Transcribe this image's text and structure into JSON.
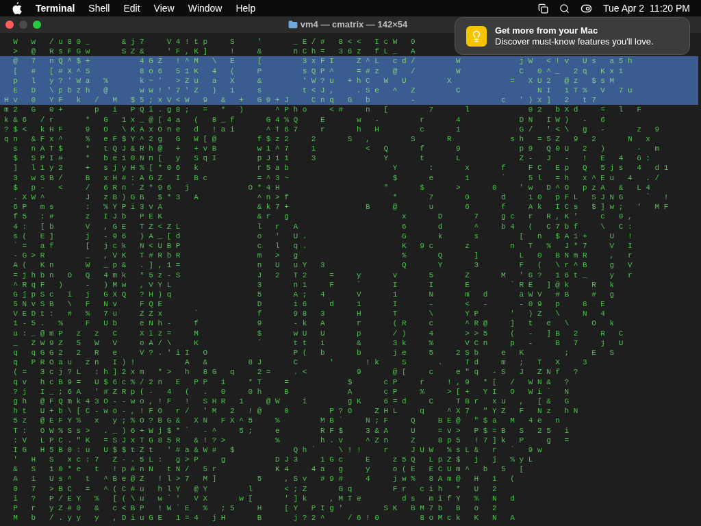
{
  "menu_bar": {
    "app_name": "Terminal",
    "items": [
      "Shell",
      "Edit",
      "View",
      "Window",
      "Help"
    ],
    "date": "Tue Apr 2",
    "time": "11:20 PM"
  },
  "window": {
    "title": "vm4 — cmatrix — 142×54"
  },
  "notification": {
    "title": "Get more from your Mac",
    "body": "Discover must-know features you'll love."
  },
  "terminal": {
    "lines": [
      {
        "text": "  W   w   / u 8 0 _       & j 7     V 4 ! t p     S     '       _ E / #   8 < <   I c W   0",
        "selected": false
      },
      {
        "text": "  >   @   R s F G w       S Z &     ' F , K ]     !     &       n C h =   3 6 z   f L _   A",
        "selected": false
      },
      {
        "text": "  @   7   n Q ^ $ +           4 G Z   ! ^ M   \\   E     [         3 x F I     Z ^ L   c d /         W             j W   < ! v   U s   a 5 h",
        "selected": true
      },
      {
        "text": "  [   #   [ # X ^ S           8 o 6   5 1 K   4   (     P         s Q P ^     = # z   @   /         W             C   0 ^ _   2 q   K x i",
        "selected": true
      },
      {
        "text": "  p   l   y ? ' W a   %       k ~ '   > Z u   a   X     &         ' W ? u   + h C   W   U         X             =   X U 2   @ z   $ s M",
        "selected": true
      },
      {
        "text": "  E   D   \\ p b z h   @       w w ! ' 7 ' Z   )   1     s         t < J ,     . S e   ^   Z         C                 N I   1 T %   V   7 u",
        "selected": true
      },
      {
        "text": "H v   0   Y F   k   /   M   $ 5 ; x V < W   9   &   +   G 9 + J     C n q   G   b         -                   c   ' ) x ]   2   t 7",
        "selected": true
      },
      {
        "text": "m 2   G   0 +       p   i   P Q i . g 8 ;   =   *   )       ^ P h o     < #     n   [         7       l             0 2   b X d     =   l   F",
        "selected": false
      },
      {
        "text": "k & 6   / r       *   G   1 x _ @ [ 4 a   (   8 _ f       G 4 % Q     E       w   -         r       4             D N   I W )   -   6",
        "selected": false
      },
      {
        "text": "? $ <   k H F     9   O   \\ K A x O n e   d   ! a i       ^ T 6 7     r       h   H         c       1             G /   ' < \\   g   -       z   9",
        "selected": false
      },
      {
        "text": "q n   & F x ^     %   e F $ Y ^ 2 g   G   W [ @         f $ z 2     2       S   ,         S       R             s h   = 5 Z   9   2       N   x",
        "selected": false
      },
      {
        "text": "  s   n A T $     *   t Q J & R h @   +   + v B         w 1 ^ 7     1           <   Q       f       9             p 9   Q 0 U   2   )       -   m",
        "selected": false
      },
      {
        "text": "  $   S P I #     *   b e i 0 N n [   y   S q I         p J i 1     3               Y       t       L             Z -   J   -   !   E   4   6 :",
        "selected": false
      },
      {
        "text": "  ]   l 1 y 2     +   s j y H % [ * 0 6   k             r 5 a b                       Y       :       x       f     F C   E p   Q   5 j s   4   d 1",
        "selected": false
      },
      {
        "text": "  3   w S B /     B   x H # : A G Z   I   B c           = ^ 3 ~                       $       e       1       `     5 l   = h   x ^ E u   4   . /",
        "selected": false
      },
      {
        "text": "  $   p -   <     /   6 R n ` Z * 9 6   j             O * 4 H                       \"       $       >       0     ' w   D ^ O   p z A   &   L 4",
        "selected": false
      },
      {
        "text": "  . X W ^         J   z B ) G B   $ * 3   A             ^ n > f                       *       7       0       d     1 0   p F L   S J N G     `   !",
        "selected": false
      },
      {
        "text": "  6 P   m s       :   % Y P i 3 v A                     & k 7 +                 B     @       u       6       f     A k   I C s   $ ] w ;   '   M F",
        "selected": false
      },
      {
        "text": "  f 5   : #       z   I J b   P E K                     & r   g                         x       D       7     g c   r   R , K '     c   0 ,",
        "selected": false
      },
      {
        "text": "  4 :   [ b       V   , G E   T Z < Z L                 l   r   A                       6       d       ^     b 4   (   C 7 b f     \\   C :",
        "selected": false
      },
      {
        "text": "  s (   E ]       j   - 9 6   ) A _ [ d                 o   '   U .                     G       k       s         [   n   $ A 1 +     U   !",
        "selected": false
      },
      {
        "text": "  ` =   a f       [   j c k   N < U B P                 c   l   q .                     K   9 c       z         n   T   %   J * 7     V   I",
        "selected": false
      },
      {
        "text": "  - G > R         _   , V K   T # R b R                 m   >   g                       %       Q       ]         L   0   B N m R     ,   r",
        "selected": false
      },
      {
        "text": "  A (   K n       W   _ p &   . ] , 1 =                 n   U   u Y   3                 Q       Y       3         F   (   \\ r ^ B     g   V",
        "selected": false
      },
      {
        "text": "  = j h b n   O   Q   4 m k   * 5 z - S                 J   2   T 2     =     y       v       5       Z       M   ' G ?   1 6 t _     y   r",
        "selected": false
      },
      {
        "text": "  ^ R q F   )     -   ) M w   , V Y L                   3       n 1     F     `       I       I       E         ` R E   ] @ k     R   k",
        "selected": false
      },
      {
        "text": "  G j p S c   i   j   G X Q   ? H ) q                   5       A ;   4       V       1       N       m   d       a W V   # B     #   g",
        "selected": false
      },
      {
        "text": "  5 N v S B   \\   F   N v     F Q E                     D       i 6     d     1       I       -       <   -       - 0 9   p     8   E",
        "selected": false
      },
      {
        "text": "  V E D t :   #   %   7 u     Z Z x       `             f       9 8   3       H       T       \\       Y P       '   ) Z   \\     N   4",
        "selected": false
      },
      {
        "text": "  i - 5 .   %     F   U b     e N h -     f             9       - k   A       r       ( R     c       ^ R @     ]   t   e   \\     O   k",
        "selected": false
      },
      {
        "text": "  u : _ @ m P   z   z   C     X i z =     M             $       w U   U       p       / )     4       > > 5     (   -   ] B   2     R   C",
        "selected": false
      },
      {
        "text": "  _   Z W 9 Z   5   W   V     o A / \\     K             `       t t   i       &       3 k     %       V C n     p   -     B   7     j   U",
        "selected": false
      },
      {
        "text": "  q   q G G 2   2   R   e     V ? . ' i I   O                   P (   b       b       j e     5     2 S b     e   K         ;     E   S",
        "selected": false
      },
      {
        "text": "  q   P R O a u   z n   I ) !           A   &         8 J       C       '       ! k     S       .     T d     m   ;   T   X     3",
        "selected": false
      },
      {
        "text": "  ( =   3 c j ? L   : h ] 2 x m   * >   h   8 G   q     2 =     . <           9       @ [     c     e \" q   - S   J   Z N f   ?",
        "selected": false
      },
      {
        "text": "  q v   h c B 9 =   U $ 6 c % / 2 n   E   P P   i     * T     =             $       c P     r     ! , 9   * [   /   W N &   ?",
        "selected": false
      },
      {
        "text": "  ? j   I _ ; 6 A   ' # Z R p ( -   4   (   .   0     0 h     B             A       c P     %     > [ +   Y I   O   W i `   N",
        "selected": false
      },
      {
        "text": "  g h   @ F Q m k 4 3 O - - w o , ! F   !   S H R   1     @ W     i         g K     6 = d     C     T B r   x u   ,   [ &   G",
        "selected": false
      },
      {
        "text": "  h t   U + b \\ [ C - w o - , ! F O   r /   ' M   2   ! @     0         P ? O     Z H L     q     ^ X 7   \" Y Z   F   N z   h N",
        "selected": false
      },
      {
        "text": "  5 z   @ E F Y %   x   y ; % O ? B G &   X N   F X ^ 5     %         M B `     N ; F     Q     B E @   \" $ a   M   4 e   n",
        "selected": false
      },
      {
        "text": "  T :   O W % S s >   . _ ) 6 + W j $ * `   - ^     5 ;     e         R F $     3 & A     U     = v >   P $ = B   S   2 5   i",
        "selected": false
      },
      {
        "text": "  : V   L P C . \" K   = S J x T G 8 5 R   & ! ? >           %         h . v     ^ Z n     Z     8 p 5   ! 7 ] k   P     g   =",
        "selected": false
      },
      {
        "text": "  I G   H 5 B 0 : u   U $ $ t Z t   ' # a & W #   $             Q h `     \\ ! !     r     J U W   % s L &   r   `   9 w",
        "selected": false
      },
      {
        "text": "  '   H   S   x c : 7   Z - . 5 L :   g > P     g           D J 3     1 G c     E     z 5 Q   L p Z $   j   j   % y L",
        "selected": false
      },
      {
        "text": "  &   S   1 0 * e   t   ! p # n N   t N /   5 r             K 4     4 a   g     y     o ( E   E C U m ^   b   5   [",
        "selected": false
      },
      {
        "text": "  A   1   U s ^   t   ^ B e @ Z   ! l > 7   M ]         5     , S v   # 9 #     4     j w %   8 A m @   H   1   (",
        "selected": false
      },
      {
        "text": "  0   7   > B C   =   ^ ( C # u   h l Y   @ Y         l       < ; Z       G q         F r   c i h   *   U   2",
        "selected": false
      },
      {
        "text": "  i   ?   P / E Y   %   [ ( \\ u   w ` '   V X       w [       ' ] k     , M T e         d s   m i f Y   %   N   d",
        "selected": false
      },
      {
        "text": "  P   r   y Z # 0   &   c < B P   ! W ` E   %   ; 5     H     [ Y   P I g '         S K   B M 7 b   B   o   2",
        "selected": false
      },
      {
        "text": "  M   b   / . y y   y   , D i u G E   1 = 4   j H       B       j ? 2 ^     / 6 ! 0         8 o M c k   K   N   A",
        "selected": false
      }
    ]
  }
}
